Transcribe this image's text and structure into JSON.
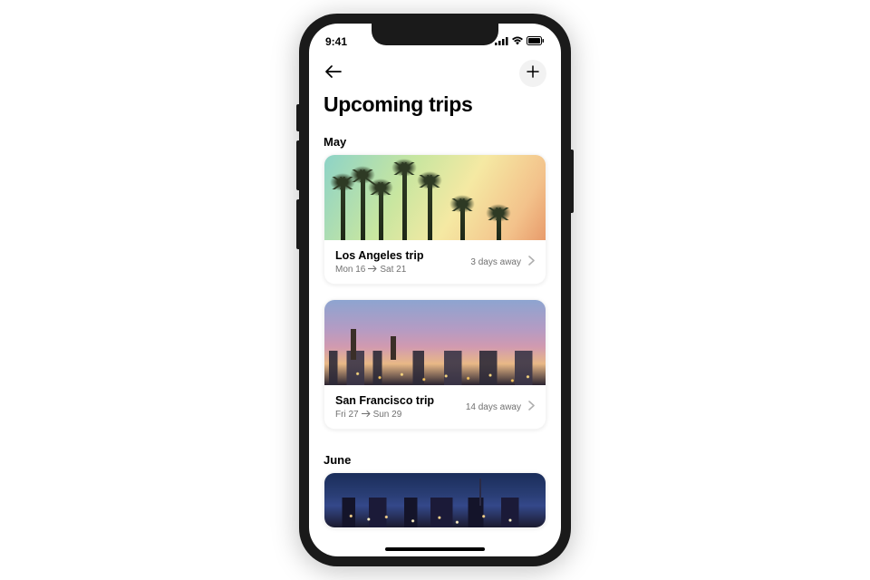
{
  "status": {
    "time": "9:41"
  },
  "header": {
    "title": "Upcoming trips"
  },
  "sections": [
    {
      "label": "May",
      "trips": [
        {
          "title": "Los Angeles trip",
          "date_from": "Mon 16",
          "date_to": "Sat 21",
          "away": "3 days away"
        },
        {
          "title": "San Francisco trip",
          "date_from": "Fri 27",
          "date_to": "Sun 29",
          "away": "14 days away"
        }
      ]
    },
    {
      "label": "June",
      "trips": []
    }
  ]
}
